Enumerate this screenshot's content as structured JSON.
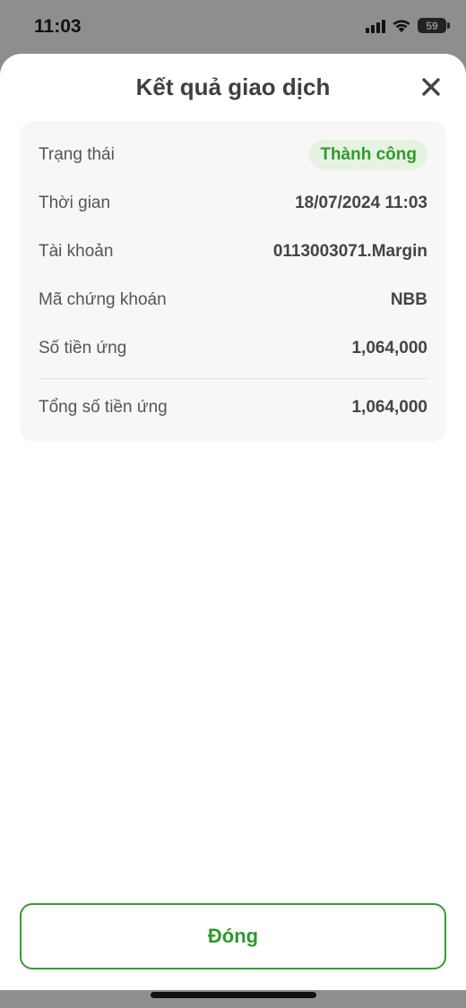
{
  "status_bar": {
    "time": "11:03",
    "battery": "59"
  },
  "sheet": {
    "title": "Kết quả giao dịch",
    "close_icon": "close-icon"
  },
  "details": {
    "status_label": "Trạng thái",
    "status_value": "Thành công",
    "time_label": "Thời gian",
    "time_value": "18/07/2024 11:03",
    "account_label": "Tài khoản",
    "account_value": "0113003071.Margin",
    "symbol_label": "Mã chứng khoán",
    "symbol_value": "NBB",
    "amount_label": "Số tiền ứng",
    "amount_value": "1,064,000",
    "total_label": "Tổng số tiền ứng",
    "total_value": "1,064,000"
  },
  "footer": {
    "close_label": "Đóng"
  },
  "colors": {
    "accent": "#2f9a2c",
    "success_bg": "#e6f3e2",
    "card_bg": "#f7f7f7"
  }
}
